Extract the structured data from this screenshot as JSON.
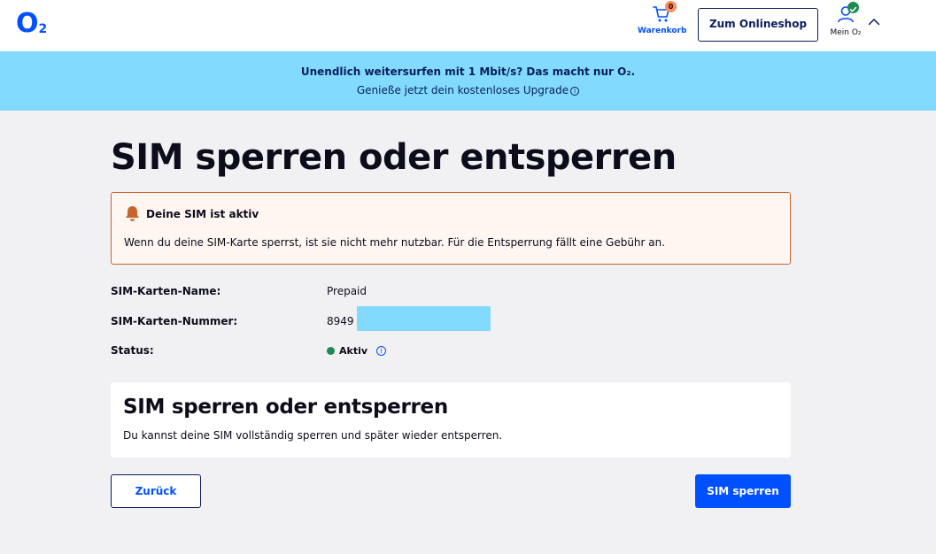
{
  "header": {
    "logo": "O",
    "logo_sub": "2",
    "cart_label": "Warenkorb",
    "cart_count": "0",
    "shop_button": "Zum Onlineshop",
    "account_label": "Mein O₂"
  },
  "banner": {
    "line1": "Unendlich weitersurfen mit 1 Mbit/s? Das macht nur O₂.",
    "line2": "Genieße jetzt dein kostenloses Upgrade"
  },
  "page": {
    "title": "SIM sperren oder entsperren"
  },
  "alert": {
    "title": "Deine SIM ist aktiv",
    "text": "Wenn du deine SIM-Karte sperrst, ist sie nicht mehr nutzbar. Für die Entsperrung fällt eine Gebühr an."
  },
  "details": {
    "name_label": "SIM-Karten-Name:",
    "name_value": "Prepaid",
    "number_label": "SIM-Karten-Nummer:",
    "number_value": "8949",
    "status_label": "Status:",
    "status_value": "Aktiv"
  },
  "card": {
    "title": "SIM sperren oder entsperren",
    "text": "Du kannst deine SIM vollständig sperren und später wieder entsperren."
  },
  "actions": {
    "back": "Zurück",
    "lock": "SIM sperren"
  },
  "colors": {
    "brand": "#0050ff",
    "banner": "#82dbff",
    "navy": "#0a1e5a",
    "status_active": "#1a8a50",
    "alert_border": "#c8652e"
  }
}
